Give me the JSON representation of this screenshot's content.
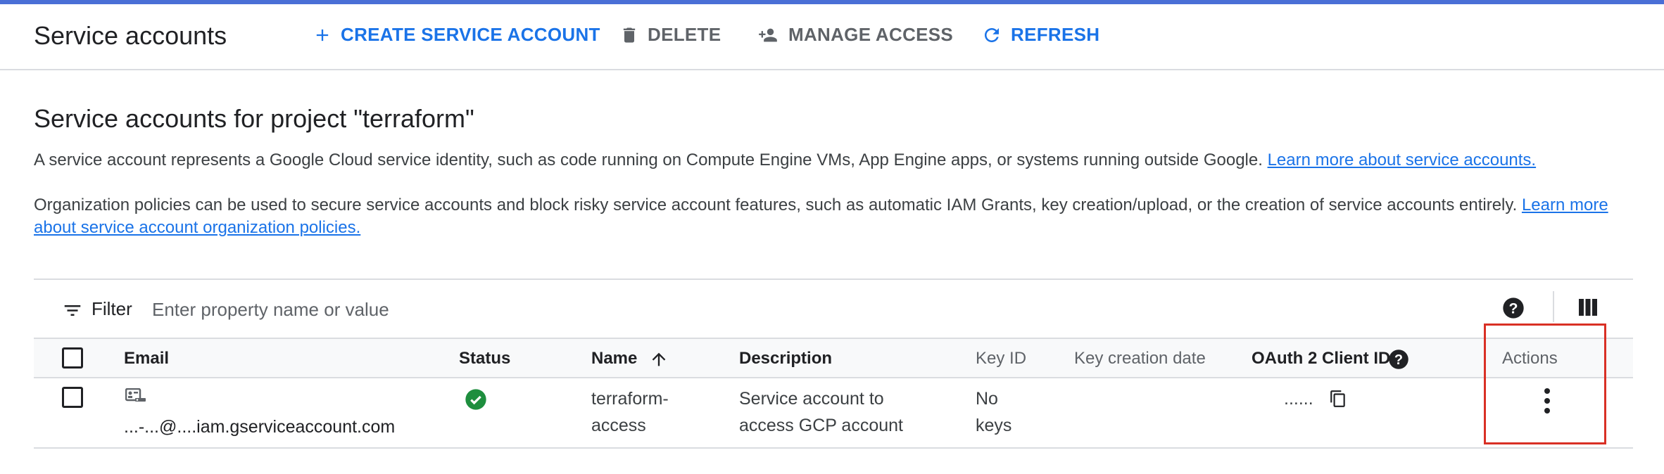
{
  "toolbar": {
    "title": "Service accounts",
    "create_label": "CREATE SERVICE ACCOUNT",
    "delete_label": "DELETE",
    "manage_label": "MANAGE ACCESS",
    "refresh_label": "REFRESH"
  },
  "page": {
    "heading": "Service accounts for project \"terraform\"",
    "desc1": "A service account represents a Google Cloud service identity, such as code running on Compute Engine VMs, App Engine apps, or systems running outside Google.",
    "desc1_link": "Learn more about service accounts.",
    "desc2": "Organization policies can be used to secure service accounts and block risky service account features, such as automatic IAM Grants, key creation/upload, or the creation of service accounts entirely.",
    "desc2_link": "Learn more about service account organization policies."
  },
  "filter": {
    "label": "Filter",
    "placeholder": "Enter property name or value"
  },
  "table": {
    "columns": {
      "email": "Email",
      "status": "Status",
      "name": "Name",
      "description": "Description",
      "key_id": "Key ID",
      "key_creation_date": "Key creation date",
      "oauth_client_id": "OAuth 2 Client ID",
      "actions": "Actions"
    },
    "sort": {
      "column": "name",
      "direction": "ascending"
    },
    "rows": [
      {
        "email": "...-...@....iam.gserviceaccount.com",
        "status": "enabled",
        "name_line1": "terraform-",
        "name_line2": "access",
        "description_line1": "Service account to",
        "description_line2": "access GCP account",
        "key_id_line1": "No",
        "key_id_line2": "keys",
        "key_creation_date": "",
        "oauth_client_id": "......"
      }
    ]
  },
  "colors": {
    "accent": "#1a73e8",
    "status_ok": "#1e8e3e",
    "highlight_box": "#d93025",
    "top_bar": "#4a6fd6"
  },
  "icons": [
    "add-icon",
    "trash-icon",
    "person-add-icon",
    "refresh-icon",
    "filter-icon",
    "help-icon",
    "column-display-icon",
    "service-account-key-icon",
    "check-circle-icon",
    "copy-icon",
    "more-vert-icon",
    "arrow-up-icon"
  ]
}
